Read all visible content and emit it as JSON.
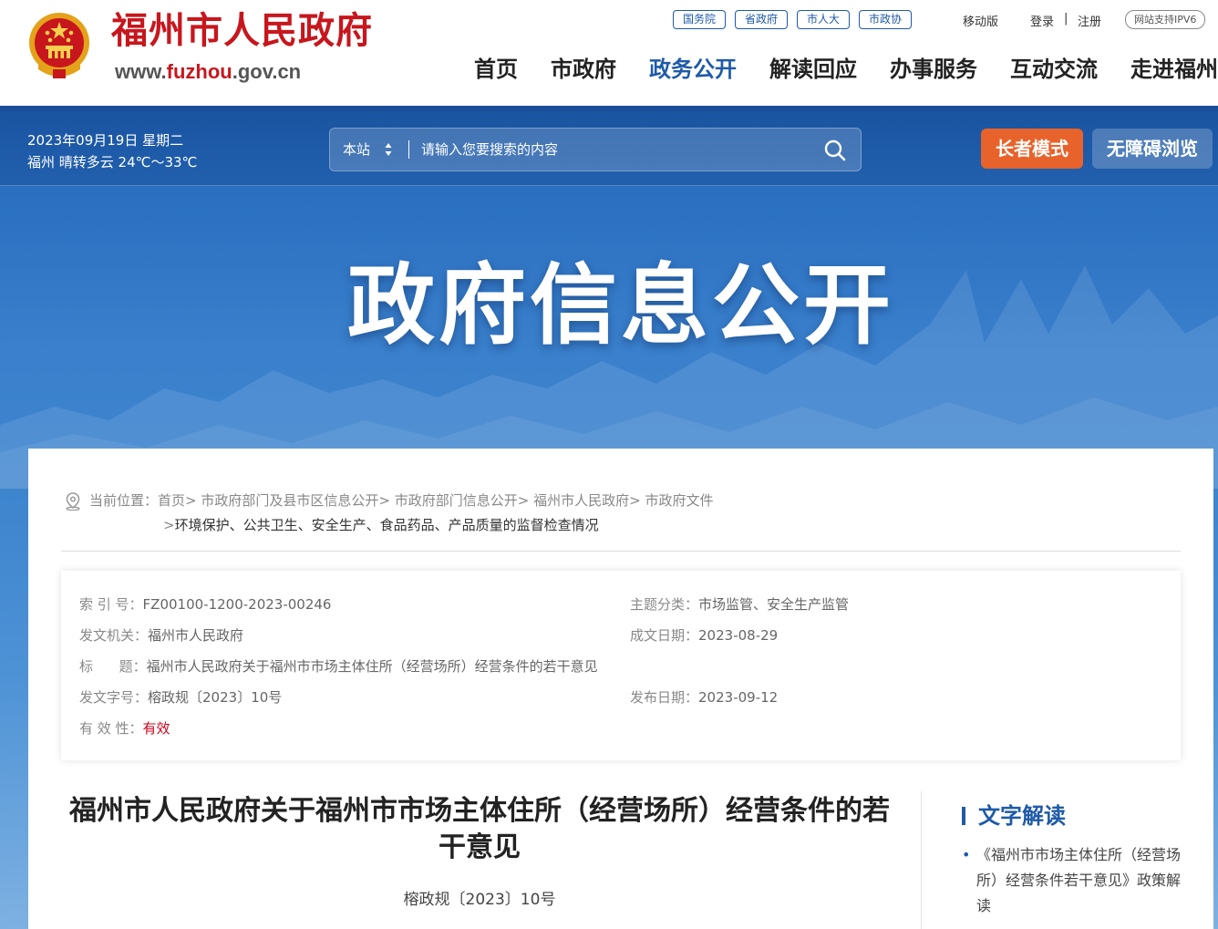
{
  "header": {
    "site_name": "福州市人民政府",
    "url_prefix": "www.",
    "url_highlight": "fuzhou",
    "url_suffix": ".gov.cn",
    "quick_links": [
      "国务院",
      "省政府",
      "市人大",
      "市政协"
    ],
    "mobile": "移动版",
    "login": "登录",
    "separator": "|",
    "register": "注册",
    "ipv6": "网站支持IPV6",
    "nav": [
      "首页",
      "市政府",
      "政务公开",
      "解读回应",
      "办事服务",
      "互动交流",
      "走进福州"
    ],
    "nav_active_index": 2
  },
  "toolbar": {
    "date": "2023年09月19日 星期二",
    "weather": "福州 晴转多云 24℃～33℃",
    "search_scope": "本站",
    "search_placeholder": "请输入您要搜索的内容",
    "elder_mode": "长者模式",
    "accessible": "无障碍浏览"
  },
  "hero": {
    "title": "政府信息公开"
  },
  "breadcrumb": {
    "label": "当前位置：",
    "items": [
      "首页",
      "市政府部门及县市区信息公开",
      "市政府部门信息公开",
      "福州市人民政府",
      "市政府文件"
    ],
    "separator": ">",
    "last": "环境保护、公共卫生、安全生产、食品药品、产品质量的监督检查情况"
  },
  "meta": {
    "index_label": "索 引 号：",
    "index_value": "FZ00100-1200-2023-00246",
    "topic_label": "主题分类：",
    "topic_value": "市场监管、安全生产监管",
    "issuer_label": "发文机关：",
    "issuer_value": "福州市人民政府",
    "created_label": "成文日期：",
    "created_value": "2023-08-29",
    "title_label": "标      题：",
    "title_value": "福州市人民政府关于福州市市场主体住所（经营场所）经营条件的若干意见",
    "docno_label": "发文字号：",
    "docno_value": "榕政规〔2023〕10号",
    "published_label": "发布日期：",
    "published_value": "2023-09-12",
    "validity_label": "有 效 性：",
    "validity_value": "有效"
  },
  "document": {
    "title": "福州市人民政府关于福州市市场主体住所（经营场所）经营条件的若干意见",
    "number": "榕政规〔2023〕10号"
  },
  "sidebar": {
    "title": "文字解读",
    "bullet": "•",
    "items": [
      "《福州市市场主体住所（经营场所）经营条件若干意见》政策解读"
    ]
  },
  "colors": {
    "brand_red": "#c8161d",
    "brand_blue": "#1e5aa8",
    "elder_orange": "#e8632b",
    "valid_red": "#d0021b"
  },
  "icons": {
    "emblem": "national-emblem-icon",
    "scope": "sort-arrows-icon",
    "search": "search-icon",
    "location": "location-pin-icon"
  }
}
